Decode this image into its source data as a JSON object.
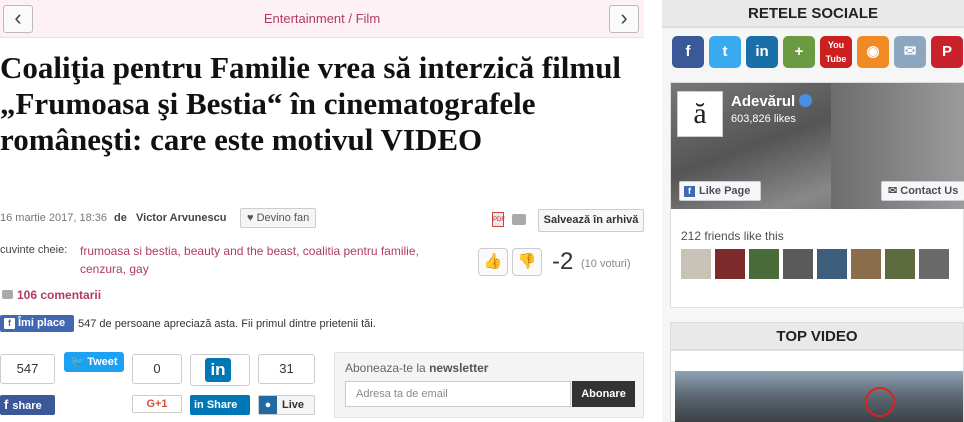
{
  "nav": {
    "prev_arrow": "‹",
    "next_arrow": "›",
    "category": "Entertainment / Film"
  },
  "article": {
    "title": "Coaliţia pentru Familie vrea să interzică filmul „Frumoasa şi Bestia“ în cinematografele româneşti: care este motivul VIDEO",
    "date": "16 martie 2017, 18:36",
    "by": "de",
    "author": "Victor Arvunescu",
    "fan_label": "Devino fan",
    "pdf_label": "PDF",
    "save_label": "Salvează în arhivă",
    "keywords_label": "cuvinte cheie:",
    "keywords": "frumoasa si bestia, beauty and the beast, coalitia pentru familie, cenzura, gay",
    "score": "-2",
    "votes": "(10 voturi)",
    "comments": "106 comentarii"
  },
  "facebook_like": {
    "button": "Îmi place",
    "text": "547 de persoane apreciază asta. Fii primul dintre prietenii tăi."
  },
  "share": {
    "fb_count": "547",
    "fb_label": "share",
    "tweet_label": "Tweet",
    "gplus_count": "0",
    "gplus_label": "G+1",
    "in_logo": "in",
    "in_label": "Share",
    "live_count": "31",
    "live_label": "Live"
  },
  "newsletter": {
    "label_prefix": "Aboneaza-te la",
    "label_bold": "newsletter",
    "placeholder": "Adresa ta de email",
    "button": "Abonare"
  },
  "sidebar": {
    "social_title": "RETELE SOCIALE",
    "icons": [
      {
        "name": "facebook-icon",
        "glyph": "f",
        "color": "#3b5998"
      },
      {
        "name": "twitter-icon",
        "glyph": "t",
        "color": "#3aaaf0"
      },
      {
        "name": "linkedin-icon",
        "glyph": "in",
        "color": "#1a6fa8"
      },
      {
        "name": "google-plus-icon",
        "glyph": "+",
        "color": "#6a9a42"
      },
      {
        "name": "youtube-icon",
        "glyph": "You Tube",
        "color": "#cc2020"
      },
      {
        "name": "rss-icon",
        "glyph": "◉",
        "color": "#f08a24"
      },
      {
        "name": "email-icon",
        "glyph": "✉",
        "color": "#8da7c0"
      },
      {
        "name": "pinterest-icon",
        "glyph": "P",
        "color": "#c8232c"
      }
    ],
    "fb_widget": {
      "logo": "ă",
      "page_name": "Adevărul",
      "likes": "603,826 likes",
      "like_page": "Like Page",
      "contact": "✉ Contact Us",
      "friends": "212 friends like this",
      "avatar_colors": [
        "#c9c3b7",
        "#7d2a2a",
        "#4a6b3a",
        "#5a5a5a",
        "#3d5e7a",
        "#8a6d4a",
        "#5d6b3f",
        "#6a6a6a"
      ]
    },
    "top_video_title": "TOP VIDEO"
  }
}
